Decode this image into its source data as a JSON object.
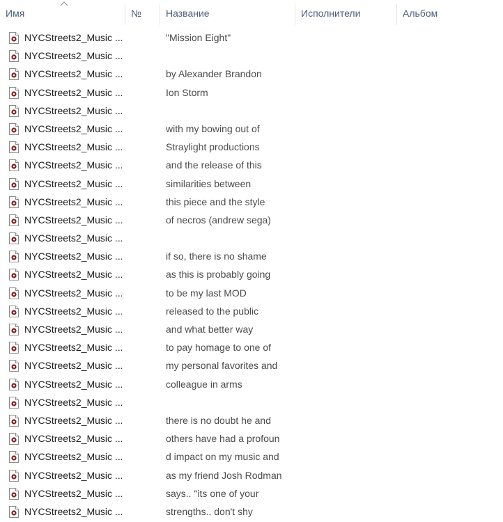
{
  "columns": {
    "name": "Имя",
    "number": "№",
    "title": "Название",
    "artists": "Исполнители",
    "album": "Альбом"
  },
  "colors": {
    "header_text": "#4c607a",
    "file_text": "#1e1e1e",
    "title_text": "#4a4a4a",
    "icon_accent": "#7a1f1f"
  },
  "files": [
    {
      "name": "NYCStreets2_Music ...",
      "title": "\"Mission Eight\""
    },
    {
      "name": "NYCStreets2_Music ...",
      "title": ""
    },
    {
      "name": "NYCStreets2_Music ...",
      "title": "by Alexander Brandon"
    },
    {
      "name": "NYCStreets2_Music ...",
      "title": "Ion Storm"
    },
    {
      "name": "NYCStreets2_Music ...",
      "title": ""
    },
    {
      "name": "NYCStreets2_Music ...",
      "title": "with my bowing out of"
    },
    {
      "name": "NYCStreets2_Music ...",
      "title": "Straylight productions"
    },
    {
      "name": "NYCStreets2_Music ...",
      "title": "and the release of this"
    },
    {
      "name": "NYCStreets2_Music ...",
      "title": "similarities between"
    },
    {
      "name": "NYCStreets2_Music ...",
      "title": "this piece and the style"
    },
    {
      "name": "NYCStreets2_Music ...",
      "title": "of necros (andrew sega)"
    },
    {
      "name": "NYCStreets2_Music ...",
      "title": ""
    },
    {
      "name": "NYCStreets2_Music ...",
      "title": "if so, there is no shame"
    },
    {
      "name": "NYCStreets2_Music ...",
      "title": "as this is probably going"
    },
    {
      "name": "NYCStreets2_Music ...",
      "title": "to be my last MOD"
    },
    {
      "name": "NYCStreets2_Music ...",
      "title": "released to the public"
    },
    {
      "name": "NYCStreets2_Music ...",
      "title": "and what better way"
    },
    {
      "name": "NYCStreets2_Music ...",
      "title": "to pay homage to one of"
    },
    {
      "name": "NYCStreets2_Music ...",
      "title": "my personal favorites and"
    },
    {
      "name": "NYCStreets2_Music ...",
      "title": "colleague in arms"
    },
    {
      "name": "NYCStreets2_Music ...",
      "title": ""
    },
    {
      "name": "NYCStreets2_Music ...",
      "title": "there is no doubt he and"
    },
    {
      "name": "NYCStreets2_Music ...",
      "title": "others have had a profoun"
    },
    {
      "name": "NYCStreets2_Music ...",
      "title": "d impact on my music and"
    },
    {
      "name": "NYCStreets2_Music ...",
      "title": "as my friend Josh Rodman"
    },
    {
      "name": "NYCStreets2_Music ...",
      "title": "says.. \"its one of your"
    },
    {
      "name": "NYCStreets2_Music ...",
      "title": "strengths.. don't shy"
    }
  ]
}
